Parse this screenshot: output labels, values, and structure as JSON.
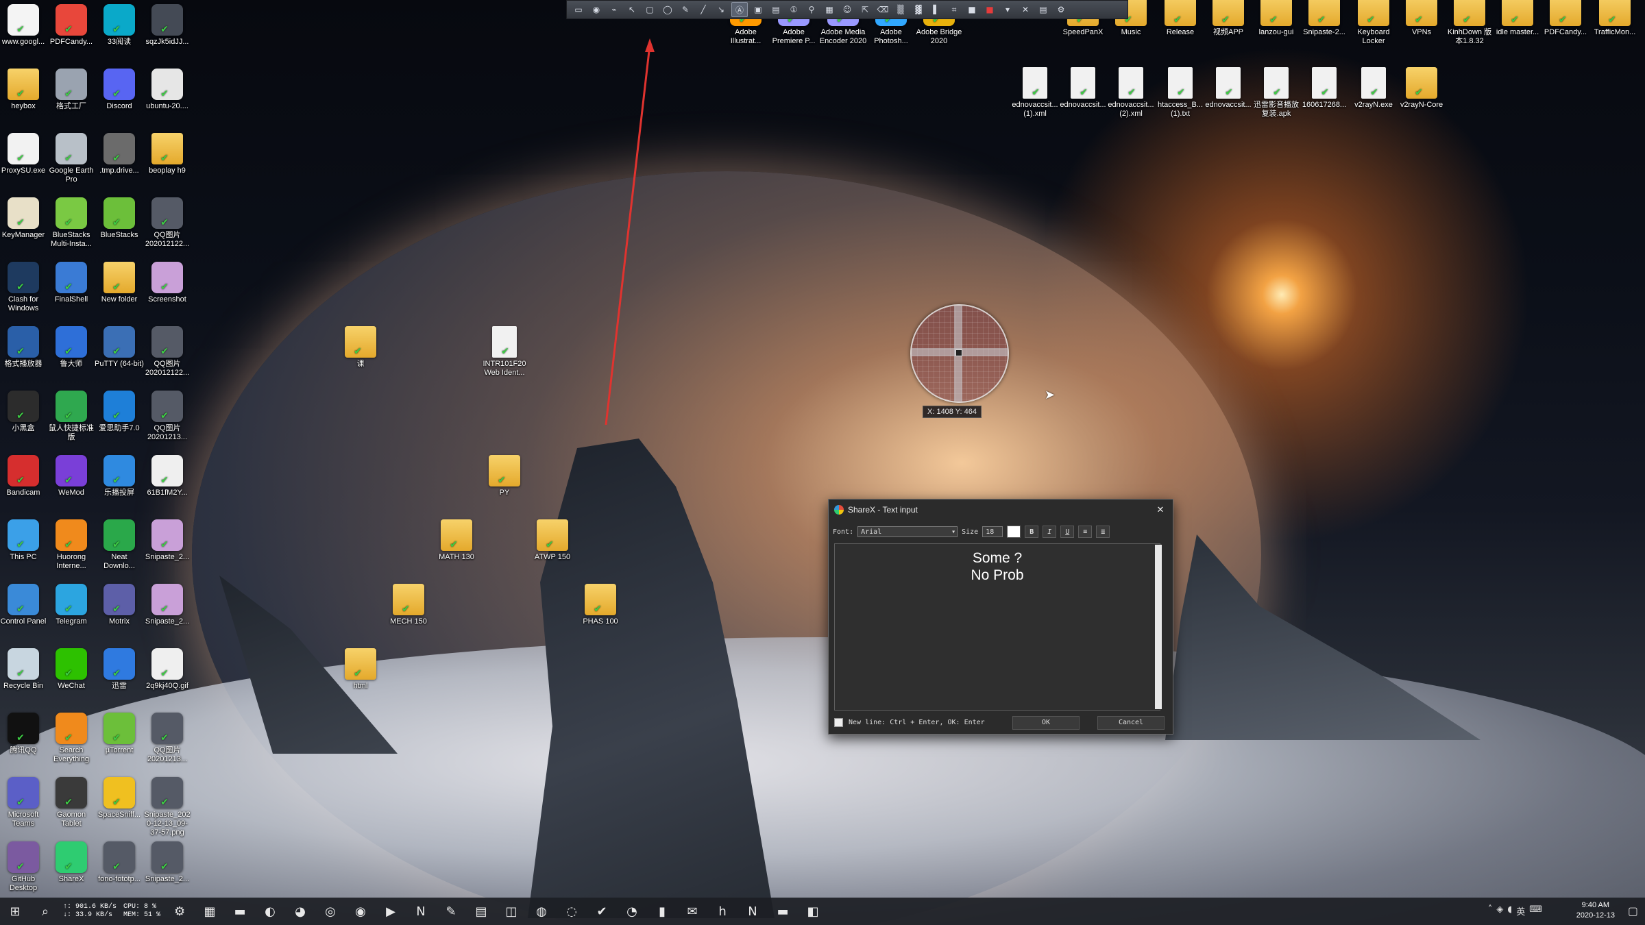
{
  "colors": {
    "arrow": "#e0332f",
    "ok_check": "#3ecf45",
    "dialog_bg": "#2b2b2b"
  },
  "desktop_left": [
    {
      "label": "www.googl...",
      "icon": "chrome-doc-icon",
      "color": "#f4f4f4"
    },
    {
      "label": "PDFCandy...",
      "icon": "pdfcandy-icon",
      "color": "#e8473b"
    },
    {
      "label": "33阅读",
      "icon": "reader-33-icon",
      "color": "#0aa9c9"
    },
    {
      "label": "sqzJk5idJJ...",
      "icon": "image-file-icon",
      "color": "#444a55"
    },
    {
      "label": "heybox",
      "icon": "folder-icon",
      "color": "#f7d26a"
    },
    {
      "label": "格式工厂",
      "icon": "format-factory-icon",
      "color": "#9aa3b0"
    },
    {
      "label": "Discord",
      "icon": "discord-icon",
      "color": "#5865f2"
    },
    {
      "label": "ubuntu-20....",
      "icon": "iso-file-icon",
      "color": "#e6e6e6"
    },
    {
      "label": "ProxySU.exe",
      "icon": "proxy-icon",
      "color": "#f2f2f2"
    },
    {
      "label": "Google Earth Pro",
      "icon": "google-earth-icon",
      "color": "#b8c0c8"
    },
    {
      "label": ".tmp.drive...",
      "icon": "drive-file-icon",
      "color": "#6b6b6b"
    },
    {
      "label": "beoplay h9",
      "icon": "folder-icon",
      "color": "#f7d26a"
    },
    {
      "label": "KeyManager",
      "icon": "key-manager-icon",
      "color": "#e8e0c8"
    },
    {
      "label": "BlueStacks Multi-Insta...",
      "icon": "bluestacks-multi-icon",
      "color": "#7ac943"
    },
    {
      "label": "BlueStacks",
      "icon": "bluestacks-icon",
      "color": "#6cbf3a"
    },
    {
      "label": "QQ图片202012122...",
      "icon": "image-file-icon",
      "color": "#555a66"
    },
    {
      "label": "Clash for Windows",
      "icon": "clash-icon",
      "color": "#1e3a5f"
    },
    {
      "label": "FinalShell",
      "icon": "finalshell-icon",
      "color": "#3a7bd5"
    },
    {
      "label": "New folder",
      "icon": "folder-icon",
      "color": "#f7d26a"
    },
    {
      "label": "Screenshot",
      "icon": "archive-icon",
      "color": "#c9a0d8"
    },
    {
      "label": "格式播放器",
      "icon": "player-icon",
      "color": "#2a5fa8"
    },
    {
      "label": "鲁大师",
      "icon": "ludashi-icon",
      "color": "#2e6fd8"
    },
    {
      "label": "PuTTY (64-bit)",
      "icon": "putty-icon",
      "color": "#3b6fb5"
    },
    {
      "label": "QQ图片202012122...",
      "icon": "image-file-icon",
      "color": "#555a66"
    },
    {
      "label": "小黑盒",
      "icon": "xiaoheihe-icon",
      "color": "#2c2c2c"
    },
    {
      "label": "鼠人快捷标准版",
      "icon": "shortcut-icon",
      "color": "#2fa84f"
    },
    {
      "label": "爱思助手7.0",
      "icon": "i4-icon",
      "color": "#1e7fd8"
    },
    {
      "label": "QQ图片20201213...",
      "icon": "image-file-icon",
      "color": "#555a66"
    },
    {
      "label": "Bandicam",
      "icon": "bandicam-icon",
      "color": "#d62e2e"
    },
    {
      "label": "WeMod",
      "icon": "wemod-icon",
      "color": "#7a3fd8"
    },
    {
      "label": "乐播投屏",
      "icon": "lebo-icon",
      "color": "#2f8ae0"
    },
    {
      "label": "61B1fM2Y...",
      "icon": "text-file-icon",
      "color": "#efefef"
    },
    {
      "label": "This PC",
      "icon": "this-pc-icon",
      "color": "#3ba0e8"
    },
    {
      "label": "Huorong Interne...",
      "icon": "huorong-icon",
      "color": "#f08a1c"
    },
    {
      "label": "Neat Downlo...",
      "icon": "neat-download-icon",
      "color": "#2aa84a"
    },
    {
      "label": "Snipaste_2...",
      "icon": "archive-icon",
      "color": "#c9a0d8"
    },
    {
      "label": "Control Panel",
      "icon": "control-panel-icon",
      "color": "#3a8ad8"
    },
    {
      "label": "Telegram",
      "icon": "telegram-icon",
      "color": "#2ca5e0"
    },
    {
      "label": "Motrix",
      "icon": "motrix-icon",
      "color": "#5d5fa8"
    },
    {
      "label": "Snipaste_2...",
      "icon": "archive-icon",
      "color": "#c9a0d8"
    },
    {
      "label": "Recycle Bin",
      "icon": "recycle-bin-icon",
      "color": "#c8d6e0"
    },
    {
      "label": "WeChat",
      "icon": "wechat-icon",
      "color": "#2dc100"
    },
    {
      "label": "迅雷",
      "icon": "thunder-icon",
      "color": "#2f7ae0"
    },
    {
      "label": "2q9kj40Q.gif",
      "icon": "gif-file-icon",
      "color": "#efefef"
    },
    {
      "label": "腾讯QQ",
      "icon": "qq-icon",
      "color": "#111"
    },
    {
      "label": "Search Everything",
      "icon": "everything-icon",
      "color": "#f08a1c"
    },
    {
      "label": "µTorrent",
      "icon": "utorrent-icon",
      "color": "#6cbf3a"
    },
    {
      "label": "QQ图片20201213...",
      "icon": "image-file-icon",
      "color": "#555a66"
    },
    {
      "label": "Microsoft Teams",
      "icon": "teams-icon",
      "color": "#5b5fc7"
    },
    {
      "label": "Gaomon Tablet",
      "icon": "gaomon-icon",
      "color": "#3a3a3a"
    },
    {
      "label": "SpaceSniff...",
      "icon": "spacesniffer-icon",
      "color": "#f0c020"
    },
    {
      "label": "Snipaste_2020-12-13_09-37-57.png",
      "icon": "image-file-icon",
      "color": "#555a66"
    },
    {
      "label": "GitHub Desktop",
      "icon": "github-icon",
      "color": "#7b5aa0"
    },
    {
      "label": "ShareX",
      "icon": "sharex-icon",
      "color": "#2ecc71"
    },
    {
      "label": "fono-fototp...",
      "icon": "image-file-icon",
      "color": "#555a66"
    },
    {
      "label": "Snipaste_2...",
      "icon": "image-file-icon",
      "color": "#555a66"
    }
  ],
  "desktop_center": [
    {
      "label": "课",
      "icon": "folder-icon"
    },
    {
      "label": "INTR101F20 Web Ident...",
      "icon": "pdf-file-icon"
    },
    {
      "label": "PY",
      "icon": "folder-icon"
    },
    {
      "label": "MATH 130",
      "icon": "folder-icon"
    },
    {
      "label": "ATWP 150",
      "icon": "folder-icon"
    },
    {
      "label": "MECH 150",
      "icon": "folder-icon"
    },
    {
      "label": "PHAS 100",
      "icon": "folder-icon"
    },
    {
      "label": "html",
      "icon": "folder-icon"
    }
  ],
  "desktop_top": [
    {
      "label": "Adobe Illustrat...",
      "icon": "illustrator-icon",
      "color": "#ff9a00"
    },
    {
      "label": "Adobe Premiere P...",
      "icon": "premiere-icon",
      "color": "#9999ff"
    },
    {
      "label": "Adobe Media Encoder 2020",
      "icon": "media-encoder-icon",
      "color": "#9999ff"
    },
    {
      "label": "Adobe Photosh...",
      "icon": "photoshop-icon",
      "color": "#31a8ff"
    },
    {
      "label": "Adobe Bridge 2020",
      "icon": "bridge-icon",
      "color": "#e8b10c"
    },
    {
      "label": "SpeedPanX",
      "icon": "folder-icon",
      "color": "#f7d26a"
    },
    {
      "label": "Music",
      "icon": "folder-icon",
      "color": "#f7d26a"
    },
    {
      "label": "Release",
      "icon": "folder-icon",
      "color": "#f7d26a"
    },
    {
      "label": "视频APP",
      "icon": "folder-icon",
      "color": "#f7d26a"
    },
    {
      "label": "lanzou-gui",
      "icon": "folder-icon",
      "color": "#f7d26a"
    },
    {
      "label": "Snipaste-2...",
      "icon": "folder-icon",
      "color": "#f7d26a"
    },
    {
      "label": "Keyboard Locker",
      "icon": "folder-icon",
      "color": "#f7d26a"
    },
    {
      "label": "VPNs",
      "icon": "folder-icon",
      "color": "#f7d26a"
    },
    {
      "label": "KinhDown 版本1.8.32",
      "icon": "folder-icon",
      "color": "#f7d26a"
    },
    {
      "label": "idle master...",
      "icon": "folder-icon",
      "color": "#f7d26a"
    },
    {
      "label": "PDFCandy...",
      "icon": "folder-icon",
      "color": "#f7d26a"
    },
    {
      "label": "TrafficMon...",
      "icon": "folder-icon",
      "color": "#f7d26a"
    }
  ],
  "desktop_top_row2": [
    {
      "label": "ednovaccsit... (1).xml",
      "icon": "xml-file-icon"
    },
    {
      "label": "ednovaccsit...",
      "icon": "xml-file-icon"
    },
    {
      "label": "ednovaccsit... (2).xml",
      "icon": "xml-file-icon"
    },
    {
      "label": "htaccess_B... (1).txt",
      "icon": "text-file-icon"
    },
    {
      "label": "ednovaccsit...",
      "icon": "xml-file-icon"
    },
    {
      "label": "迅雷影音播放复装.apk",
      "icon": "apk-file-icon"
    },
    {
      "label": "160617268...",
      "icon": "note-file-icon"
    },
    {
      "label": "v2rayN.exe",
      "icon": "v2rayn-icon"
    },
    {
      "label": "v2rayN-Core",
      "icon": "folder-icon"
    }
  ],
  "toolbar": {
    "tools": [
      "region-tool-icon",
      "ellipse-region-icon",
      "freehand-region-icon",
      "select-tool-icon",
      "rectangle-tool-icon",
      "ellipse-tool-icon",
      "freehand-tool-icon",
      "line-tool-icon",
      "arrow-tool-icon",
      "text-outline-tool-icon",
      "text-bg-tool-icon",
      "speech-balloon-tool-icon",
      "step-tool-icon",
      "magnify-tool-icon",
      "image-tool-icon",
      "sticker-tool-icon",
      "cursor-tool-icon",
      "smart-eraser-icon",
      "blur-tool-icon",
      "pixelate-tool-icon",
      "highlight-tool-icon",
      "crop-tool-icon",
      "border-color-icon",
      "fill-color-icon",
      "tool-options-icon",
      "delete-icon",
      "capture-options-icon",
      "settings-icon"
    ],
    "active_index": 9
  },
  "magnifier": {
    "coordinates": "X: 1408 Y: 464"
  },
  "dialog": {
    "title": "ShareX - Text input",
    "font_label": "Font:",
    "font_value": "Arial",
    "size_label": "Size",
    "size_value": "18",
    "bold": "B",
    "italic": "I",
    "underline": "U",
    "text": "Some ?\nNo Prob",
    "hint": "New line: Ctrl + Enter, OK: Enter",
    "ok": "OK",
    "cancel": "Cancel"
  },
  "taskbar": {
    "net_up": "↑: 901.6 KB/s",
    "net_down": "↓: 33.9 KB/s",
    "cpu": "CPU: 8 %",
    "mem": "MEM: 51 %",
    "time": "9:40 AM",
    "date": "2020-12-13",
    "apps": [
      "settings-icon",
      "store-icon",
      "file-explorer-icon",
      "edge-icon",
      "firefox-icon",
      "chrome-icon",
      "netease-music-icon",
      "zoom-icon",
      "onenote-icon",
      "pen-icon",
      "calendar-icon",
      "outlook-icon",
      "steam-icon",
      "steam-link-icon",
      "robinhood-icon",
      "github-icon",
      "terminal-icon",
      "mail-icon",
      "hulu-icon",
      "netflix-icon",
      "app-icon",
      "teams-icon"
    ]
  }
}
